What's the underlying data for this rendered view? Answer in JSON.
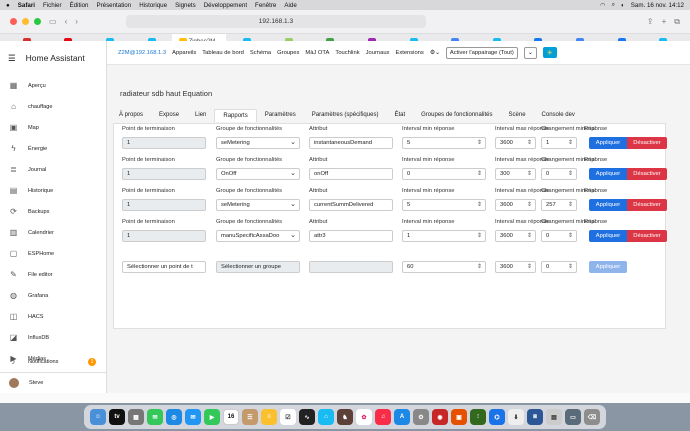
{
  "menubar": {
    "apple": "",
    "app": "Safari",
    "items": [
      "Fichier",
      "Édition",
      "Présentation",
      "Historique",
      "Signets",
      "Développement",
      "Fenêtre",
      "Aide"
    ],
    "datetime": "Sam. 16 nov.  14:12"
  },
  "browser": {
    "url": "192.168.1.3",
    "tabs": [
      {
        "label": "",
        "color": "#d32f2f",
        "active": false
      },
      {
        "label": "",
        "color": "#e50914",
        "active": false
      },
      {
        "label": "",
        "color": "#18bcf2",
        "active": false
      },
      {
        "label": "",
        "color": "#18bcf2",
        "active": false
      },
      {
        "label": "Zigbee2M...",
        "color": "#ffc107",
        "active": true
      },
      {
        "label": "",
        "color": "#18bcf2",
        "active": false
      },
      {
        "label": "",
        "color": "#9ccc65",
        "active": false
      },
      {
        "label": "",
        "color": "#43a047",
        "active": false
      },
      {
        "label": "",
        "color": "#9c27b0",
        "active": false
      },
      {
        "label": "",
        "color": "#18bcf2",
        "active": false
      },
      {
        "label": "",
        "color": "#4285f4",
        "active": false
      },
      {
        "label": "",
        "color": "#18bcf2",
        "active": false
      },
      {
        "label": "",
        "color": "#1877f2",
        "active": false
      },
      {
        "label": "",
        "color": "#4285f4",
        "active": false
      },
      {
        "label": "",
        "color": "#1877f2",
        "active": false
      },
      {
        "label": "",
        "color": "#18bcf2",
        "active": false
      }
    ]
  },
  "sidebar": {
    "title": "Home Assistant",
    "items": [
      {
        "label": "Aperçu",
        "icon": "▦"
      },
      {
        "label": "chauffage",
        "icon": "⌂"
      },
      {
        "label": "Map",
        "icon": "▣"
      },
      {
        "label": "Énergie",
        "icon": "ϟ"
      },
      {
        "label": "Journal",
        "icon": "≣"
      },
      {
        "label": "Historique",
        "icon": "▤"
      },
      {
        "label": "Backups",
        "icon": "⟳"
      },
      {
        "label": "Calendrier",
        "icon": "▥"
      },
      {
        "label": "ESPHome",
        "icon": "▢"
      },
      {
        "label": "File editor",
        "icon": "✎"
      },
      {
        "label": "Grafana",
        "icon": "◍"
      },
      {
        "label": "HACS",
        "icon": "◫"
      },
      {
        "label": "InfluxDB",
        "icon": "◪"
      },
      {
        "label": "Médias",
        "icon": "▶"
      }
    ],
    "notifications": "Notifications",
    "notif_count": "1",
    "user": "Steve"
  },
  "z2m": {
    "brand": "Z2M@192.168.1.3",
    "nav": [
      "Appareils",
      "Tableau de bord",
      "Schéma",
      "Groupes",
      "MàJ OTA",
      "Touchlink",
      "Journaux",
      "Extensions"
    ],
    "pairing": "Activer l'appairage (Tout)",
    "device": "radiateur sdb haut Equation",
    "tabs": [
      "À propos",
      "Expose",
      "Lien",
      "Rapports",
      "Paramètres",
      "Paramètres (spécifiques)",
      "État",
      "Groupes de fonctionnalités",
      "Scène",
      "Console dev"
    ],
    "active_tab": "Rapports",
    "headers": {
      "endpoint": "Point de terminaison",
      "cluster": "Groupe de fonctionnalités",
      "attribute": "Attribut",
      "min": "Interval min réponse",
      "max": "Interval max réponse",
      "change": "Changement minimal",
      "response": "Réponse"
    },
    "rows": [
      {
        "endpoint": "1",
        "cluster": "seMetering",
        "attribute": "instantaneousDemand",
        "min": "5",
        "max": "3600",
        "change": "1",
        "apply": "Appliquer",
        "disable": "Désactiver"
      },
      {
        "endpoint": "1",
        "cluster": "OnOff",
        "attribute": "onOff",
        "min": "0",
        "max": "300",
        "change": "0",
        "apply": "Appliquer",
        "disable": "Désactiver"
      },
      {
        "endpoint": "1",
        "cluster": "seMetering",
        "attribute": "currentSummDelivered",
        "min": "5",
        "max": "3600",
        "change": "257",
        "apply": "Appliquer",
        "disable": "Désactiver"
      },
      {
        "endpoint": "1",
        "cluster": "manuSpecificAssaDoo",
        "attribute": "attr3",
        "min": "1",
        "max": "3600",
        "change": "0",
        "apply": "Appliquer",
        "disable": "Désactiver"
      }
    ],
    "new_row": {
      "endpoint": "Sélectionner un point de t",
      "cluster": "Sélectionner un groupe",
      "attribute": "",
      "min": "60",
      "max": "3600",
      "change": "0",
      "apply": "Appliquer"
    }
  },
  "dock": {
    "calendar_day": "16"
  }
}
